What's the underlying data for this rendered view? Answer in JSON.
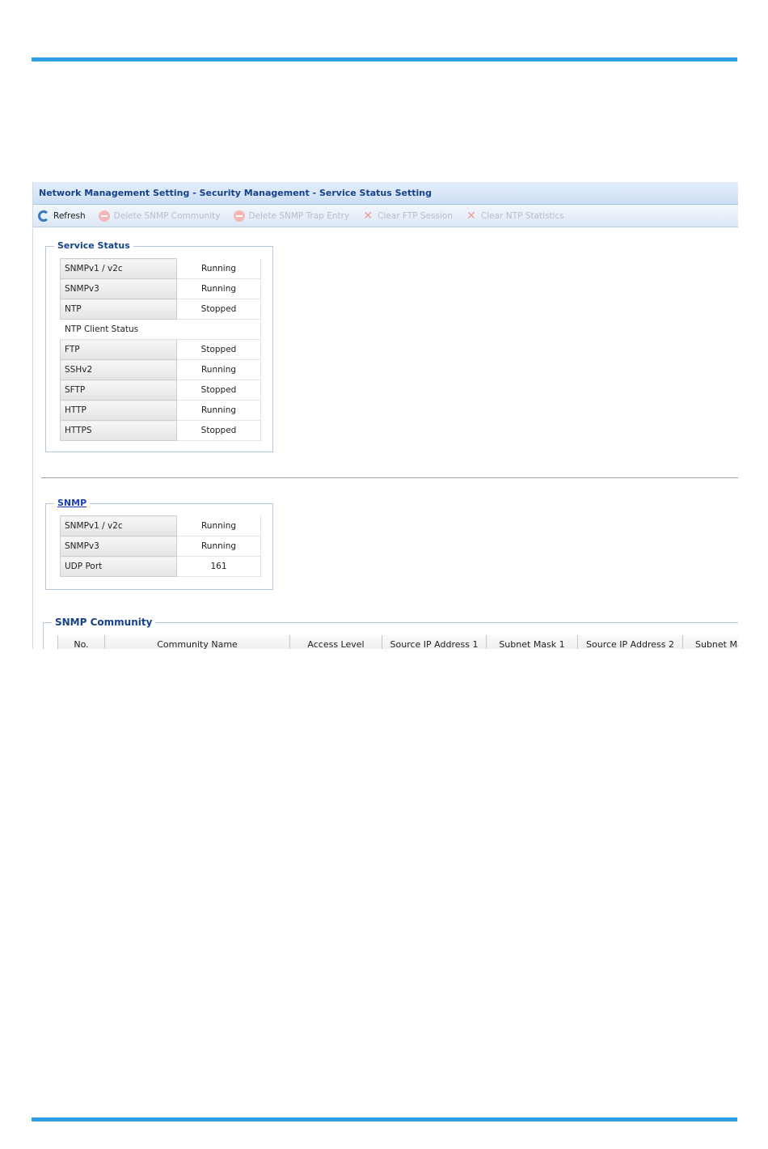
{
  "window": {
    "title": "Network Management Setting - Security Management - Service Status Setting"
  },
  "toolbar": {
    "refresh": "Refresh",
    "delete_community": "Delete SNMP Community",
    "delete_trap": "Delete SNMP Trap Entry",
    "clear_ftp": "Clear FTP Session",
    "clear_ntp": "Clear NTP Statistics"
  },
  "service_status": {
    "legend": "Service Status",
    "rows": [
      {
        "name": "SNMPv1 / v2c",
        "value": "Running"
      },
      {
        "name": "SNMPv3",
        "value": "Running"
      },
      {
        "name": "NTP",
        "value": "Stopped"
      },
      {
        "name": "NTP Client Status",
        "value": ""
      },
      {
        "name": "FTP",
        "value": "Stopped"
      },
      {
        "name": "SSHv2",
        "value": "Running"
      },
      {
        "name": "SFTP",
        "value": "Stopped"
      },
      {
        "name": "HTTP",
        "value": "Running"
      },
      {
        "name": "HTTPS",
        "value": "Stopped"
      }
    ]
  },
  "snmp": {
    "legend": "SNMP",
    "rows": [
      {
        "name": "SNMPv1 / v2c",
        "value": "Running"
      },
      {
        "name": "SNMPv3",
        "value": "Running"
      },
      {
        "name": "UDP Port",
        "value": "161"
      }
    ]
  },
  "snmp_community": {
    "legend": "SNMP Community",
    "columns": [
      "No.",
      "Community Name",
      "Access Level",
      "Source IP Address 1",
      "Subnet Mask 1",
      "Source IP Address 2",
      "Subnet Ma"
    ]
  }
}
